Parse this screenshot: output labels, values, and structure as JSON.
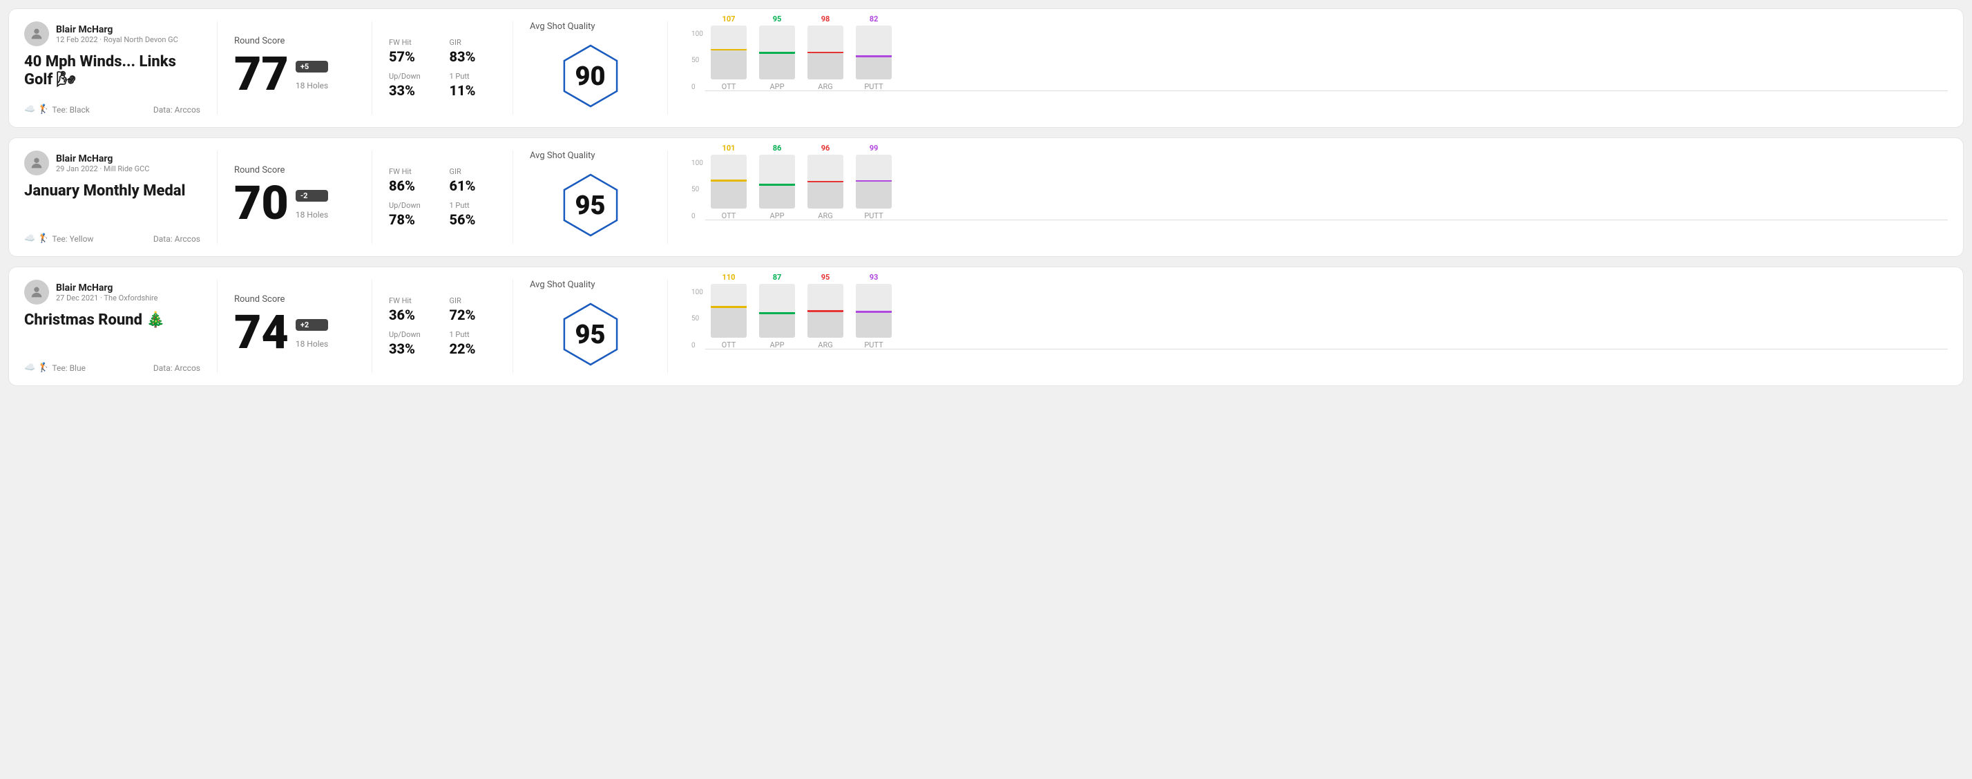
{
  "rounds": [
    {
      "id": "round1",
      "user": {
        "name": "Blair McHarg",
        "date_course": "12 Feb 2022 · Royal North Devon GC"
      },
      "title": "40 Mph Winds... Links Golf 🌬",
      "tee": "Black",
      "data_source": "Data: Arccos",
      "round_score_label": "Round Score",
      "score": "77",
      "score_modifier": "+5",
      "holes": "18 Holes",
      "fw_hit_label": "FW Hit",
      "fw_hit": "57%",
      "gir_label": "GIR",
      "gir": "83%",
      "updown_label": "Up/Down",
      "updown": "33%",
      "oneputt_label": "1 Putt",
      "oneputt": "11%",
      "quality_label": "Avg Shot Quality",
      "quality_score": "90",
      "chart": {
        "ott": {
          "value": 107,
          "color": "#e6b800",
          "height_pct": 68
        },
        "app": {
          "value": 95,
          "color": "#00b050",
          "height_pct": 60
        },
        "arg": {
          "value": 98,
          "color": "#e63333",
          "height_pct": 62
        },
        "putt": {
          "value": 82,
          "color": "#b048e0",
          "height_pct": 52
        }
      }
    },
    {
      "id": "round2",
      "user": {
        "name": "Blair McHarg",
        "date_course": "29 Jan 2022 · Mill Ride GCC"
      },
      "title": "January Monthly Medal",
      "tee": "Yellow",
      "data_source": "Data: Arccos",
      "round_score_label": "Round Score",
      "score": "70",
      "score_modifier": "-2",
      "holes": "18 Holes",
      "fw_hit_label": "FW Hit",
      "fw_hit": "86%",
      "gir_label": "GIR",
      "gir": "61%",
      "updown_label": "Up/Down",
      "updown": "78%",
      "oneputt_label": "1 Putt",
      "oneputt": "56%",
      "quality_label": "Avg Shot Quality",
      "quality_score": "95",
      "chart": {
        "ott": {
          "value": 101,
          "color": "#e6b800",
          "height_pct": 64
        },
        "app": {
          "value": 86,
          "color": "#00b050",
          "height_pct": 54
        },
        "arg": {
          "value": 96,
          "color": "#e63333",
          "height_pct": 61
        },
        "putt": {
          "value": 99,
          "color": "#b048e0",
          "height_pct": 63
        }
      }
    },
    {
      "id": "round3",
      "user": {
        "name": "Blair McHarg",
        "date_course": "27 Dec 2021 · The Oxfordshire"
      },
      "title": "Christmas Round 🎄",
      "tee": "Blue",
      "data_source": "Data: Arccos",
      "round_score_label": "Round Score",
      "score": "74",
      "score_modifier": "+2",
      "holes": "18 Holes",
      "fw_hit_label": "FW Hit",
      "fw_hit": "36%",
      "gir_label": "GIR",
      "gir": "72%",
      "updown_label": "Up/Down",
      "updown": "33%",
      "oneputt_label": "1 Putt",
      "oneputt": "22%",
      "quality_label": "Avg Shot Quality",
      "quality_score": "95",
      "chart": {
        "ott": {
          "value": 110,
          "color": "#e6b800",
          "height_pct": 70
        },
        "app": {
          "value": 87,
          "color": "#00b050",
          "height_pct": 55
        },
        "arg": {
          "value": 95,
          "color": "#e63333",
          "height_pct": 60
        },
        "putt": {
          "value": 93,
          "color": "#b048e0",
          "height_pct": 59
        }
      }
    }
  ],
  "chart_y_labels": [
    "100",
    "50",
    "0"
  ],
  "chart_categories": [
    "OTT",
    "APP",
    "ARG",
    "PUTT"
  ]
}
